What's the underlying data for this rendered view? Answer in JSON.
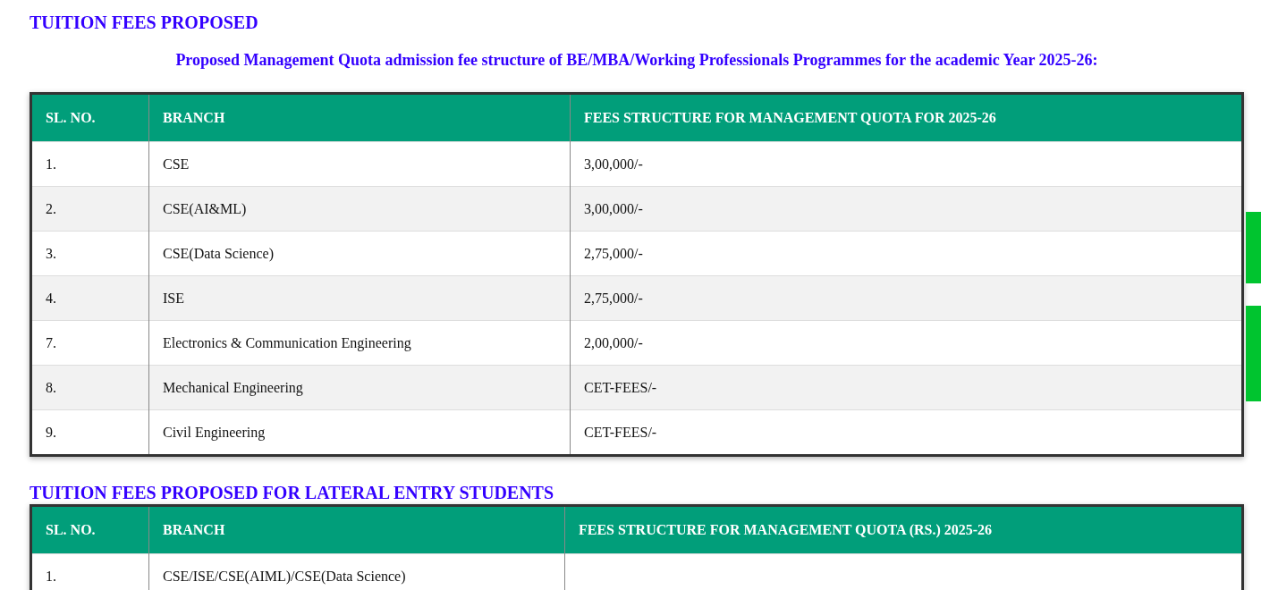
{
  "sections": [
    {
      "title": "TUITION FEES PROPOSED",
      "subtitle": "Proposed Management Quota admission fee structure of BE/MBA/Working Professionals Programmes for the academic Year 2025-26:",
      "columns": [
        "SL. NO.",
        "BRANCH",
        "FEES STRUCTURE FOR MANAGEMENT QUOTA FOR 2025-26"
      ],
      "rows": [
        [
          "1.",
          "CSE",
          "3,00,000/-"
        ],
        [
          "2.",
          "CSE(AI&ML)",
          "3,00,000/-"
        ],
        [
          "3.",
          "CSE(Data Science)",
          "2,75,000/-"
        ],
        [
          "4.",
          "ISE",
          "2,75,000/-"
        ],
        [
          "7.",
          "Electronics & Communication Engineering",
          "2,00,000/-"
        ],
        [
          "8.",
          "Mechanical Engineering",
          "CET-FEES/-"
        ],
        [
          "9.",
          "Civil Engineering",
          "CET-FEES/-"
        ]
      ]
    },
    {
      "title": "TUITION FEES PROPOSED FOR LATERAL ENTRY STUDENTS",
      "columns": [
        "SL. NO.",
        "BRANCH",
        "FEES STRUCTURE FOR MANAGEMENT QUOTA (RS.) 2025-26"
      ],
      "rows": [
        [
          "1.",
          "CSE/ISE/CSE(AIML)/CSE(Data Science)",
          ""
        ]
      ]
    }
  ]
}
